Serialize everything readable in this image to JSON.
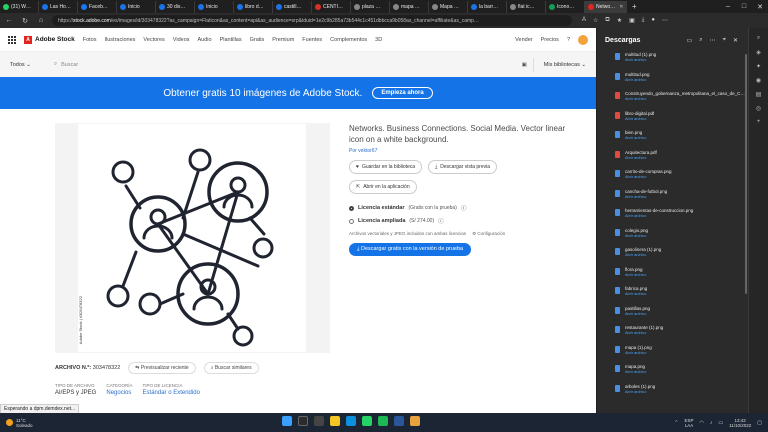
{
  "tabs": [
    {
      "label": "(31) W…",
      "color": "#25d366"
    },
    {
      "label": "Las Ho…",
      "color": "#1a73e8"
    },
    {
      "label": "Faceb…",
      "color": "#1877f2"
    },
    {
      "label": "Inicio",
      "color": "#1a73e8"
    },
    {
      "label": "30 dis…",
      "color": "#1a73e8"
    },
    {
      "label": "Inicio",
      "color": "#1a73e8"
    },
    {
      "label": "libro d…",
      "color": "#1a73e8"
    },
    {
      "label": "castill…",
      "color": "#1a73e8"
    },
    {
      "label": "CENTI…",
      "color": "#d93025"
    },
    {
      "label": "plaza …",
      "color": "#888888"
    },
    {
      "label": "mapa …",
      "color": "#888888"
    },
    {
      "label": "Mapa …",
      "color": "#888888"
    },
    {
      "label": "la barr…",
      "color": "#1a73e8"
    },
    {
      "label": "flat ic…",
      "color": "#888888"
    },
    {
      "label": "Icono…",
      "color": "#0f9d58"
    },
    {
      "label": "Netwo…",
      "color": "#e0261f",
      "active": true
    }
  ],
  "address": {
    "host": "stock.adobe.com",
    "path": "/es/images/id/303478322?as_campaign=Flaticon&as_content=api&as_audience=srp&tduid=1e2c9b285a73b544c1c451dbbcca9b058as_channel=affiliate&as_camp…",
    "scheme": "https://"
  },
  "stocknav": {
    "brand": "Adobe Stock",
    "links": [
      "Fotos",
      "Ilustraciones",
      "Vectores",
      "Videos",
      "Audio",
      "Plantillas",
      "Gratis",
      "Premium",
      "Fuentes",
      "Complementos",
      "3D"
    ],
    "vender": "Vender",
    "precios": "Precios"
  },
  "search": {
    "scope": "Todos",
    "placeholder": "Buscar",
    "libraries": "Mis bibliotecas"
  },
  "promo": {
    "text": "Obtener gratis 10 imágenes de Adobe Stock.",
    "button": "Empieza ahora"
  },
  "asset": {
    "watermark": "Adobe Stock | #303478322",
    "title": "Networks. Business Connections. Social Media. Vector linear icon on a white background.",
    "byline": "Por vektor67",
    "save": "Guardar en la biblioteca",
    "preview": "Descargar vista previa",
    "open_app": "Abrir en la aplicación",
    "license_standard": "Licencia estándar",
    "license_standard_note": "(Gratis con la prueba)",
    "license_extended": "Licencia ampliada",
    "license_extended_note": "(S/ 274.00)",
    "files_note": "Archivos vectoriales y JPEG incluidos con ambas licencias",
    "config": "Configuración",
    "cta": "Descargar gratis con la versión de prueba",
    "file_no_label": "ARCHIVO N.º:",
    "file_no": "303478322",
    "view_recent": "Previsualizar reciente",
    "find_similar": "Buscar similares",
    "type_label": "TIPO DE ARCHIVO",
    "type_value": "AI/EPS y JPEG",
    "category_label": "CATEGORÍA",
    "category_value": "Negocios",
    "license_label": "TIPO DE LICENCIA",
    "license_value": "Estándar o Extendido"
  },
  "status": "Esperando a dpm.demdex.net...",
  "downloads": {
    "title": "Descargas",
    "open_label": "Abrir archivo",
    "items": [
      {
        "name": "multitud (1).png",
        "color": "#4a90e2"
      },
      {
        "name": "multitud.png",
        "color": "#4a90e2"
      },
      {
        "name": "Construyendo_gobernanza_metropolitana_el_caso_de_C…",
        "color": "#e04a3f"
      },
      {
        "name": "libro-digital.pdf",
        "color": "#e04a3f"
      },
      {
        "name": "bien.png",
        "color": "#4a90e2"
      },
      {
        "name": "Arquitectura.pdf",
        "color": "#e04a3f"
      },
      {
        "name": "carrito-de-compras.png",
        "color": "#4a90e2"
      },
      {
        "name": "cancha-de-futbol.png",
        "color": "#4a90e2"
      },
      {
        "name": "herramientas-de-construccion.png",
        "color": "#4a90e2"
      },
      {
        "name": "colegio.png",
        "color": "#4a90e2"
      },
      {
        "name": "gasolinera (1).png",
        "color": "#4a90e2"
      },
      {
        "name": "flora.png",
        "color": "#4a90e2"
      },
      {
        "name": "fabrica.png",
        "color": "#4a90e2"
      },
      {
        "name": "pastillas.png",
        "color": "#4a90e2"
      },
      {
        "name": "restaurante (1).png",
        "color": "#4a90e2"
      },
      {
        "name": "mapa (1).png",
        "color": "#4a90e2"
      },
      {
        "name": "mapa.png",
        "color": "#4a90e2"
      },
      {
        "name": "arboles (1).png",
        "color": "#4a90e2"
      }
    ]
  },
  "taskbar": {
    "temp": "11°C",
    "weather": "Soleado",
    "lang1": "ESP",
    "lang2": "LAA",
    "time": "13:42",
    "date": "11/10/2022"
  }
}
